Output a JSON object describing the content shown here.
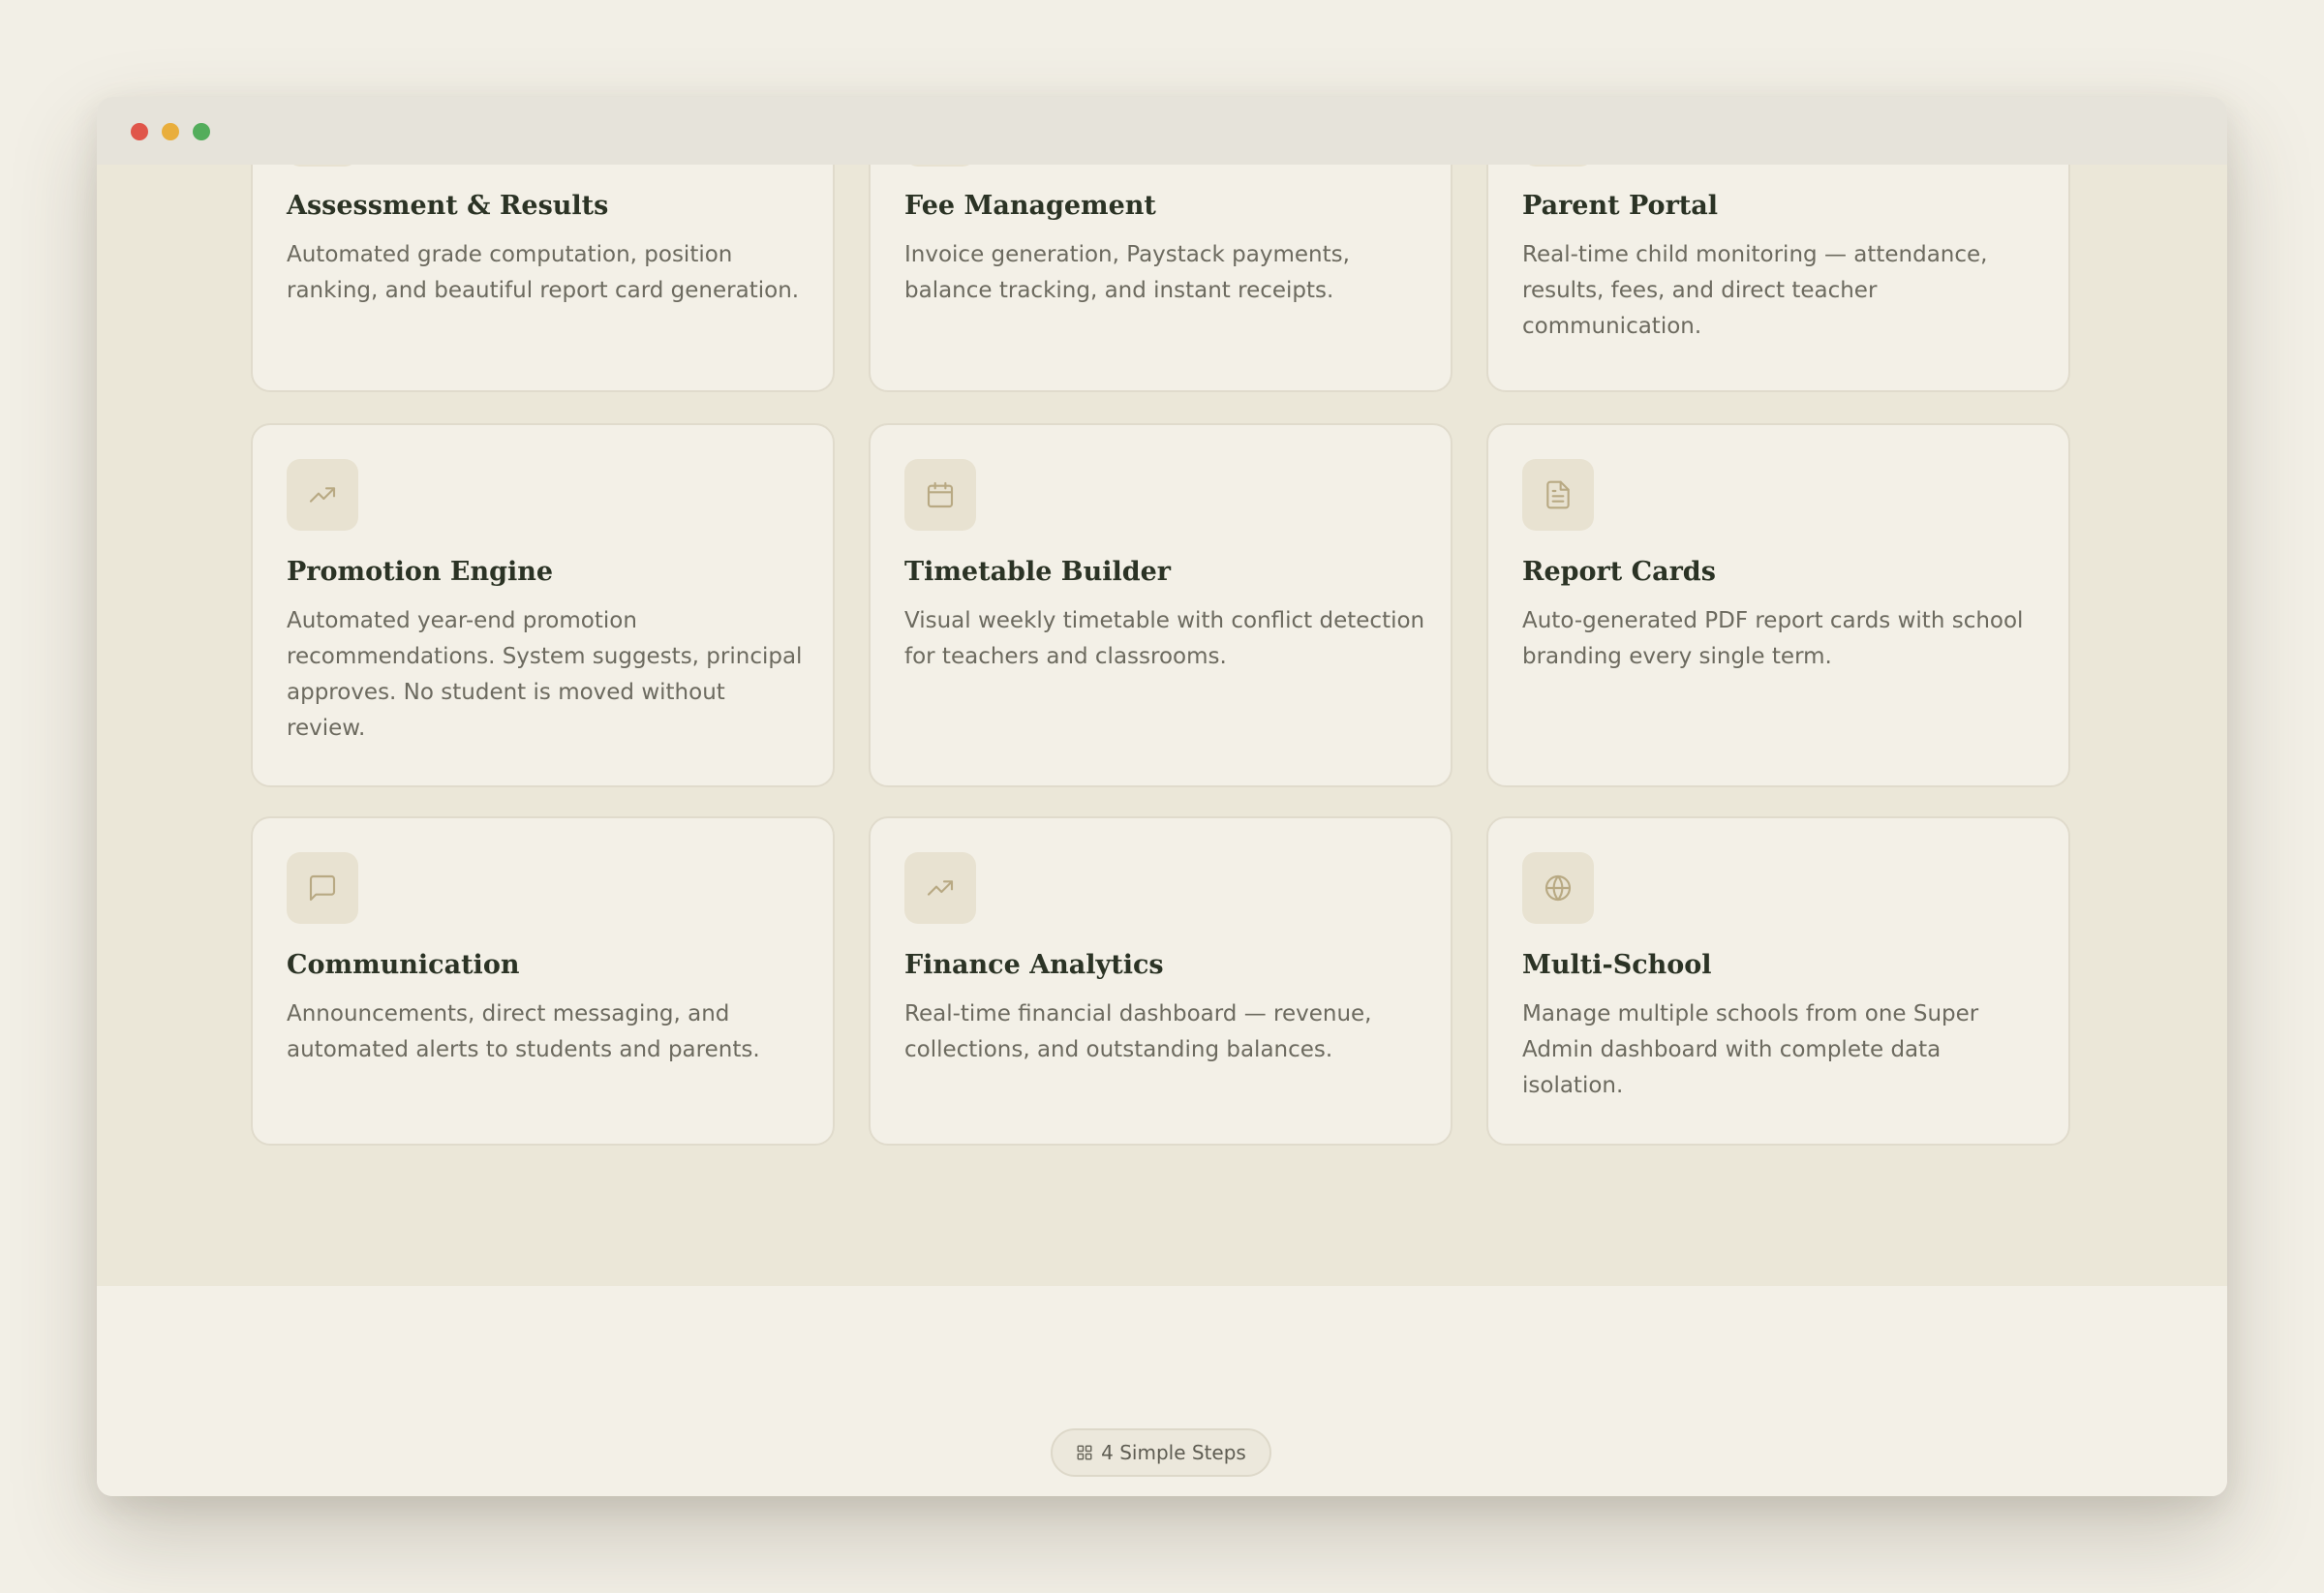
{
  "window": {
    "controls": [
      "close",
      "minimize",
      "maximize"
    ]
  },
  "features": [
    {
      "title": "Assessment & Results",
      "description": "Automated grade computation, position ranking, and beautiful report card generation."
    },
    {
      "title": "Fee Management",
      "description": "Invoice generation, Paystack payments, balance tracking, and instant receipts."
    },
    {
      "title": "Parent Portal",
      "description": "Real-time child monitoring — attendance, results, fees, and direct teacher communication."
    },
    {
      "title": "Promotion Engine",
      "icon": "trending-up-icon",
      "description": "Automated year-end promotion recommendations. System suggests, principal approves. No student is moved without review."
    },
    {
      "title": "Timetable Builder",
      "icon": "calendar-icon",
      "description": "Visual weekly timetable with conflict detection for teachers and classrooms."
    },
    {
      "title": "Report Cards",
      "icon": "file-text-icon",
      "description": "Auto-generated PDF report cards with school branding every single term."
    },
    {
      "title": "Communication",
      "icon": "message-square-icon",
      "description": "Announcements, direct messaging, and automated alerts to students and parents."
    },
    {
      "title": "Finance Analytics",
      "icon": "trending-up-icon",
      "description": "Real-time financial dashboard — revenue, collections, and outstanding balances."
    },
    {
      "title": "Multi-School",
      "icon": "globe-icon",
      "description": "Manage multiple schools from one Super Admin dashboard with complete data isolation."
    }
  ],
  "steps_badge": {
    "icon": "grid-icon",
    "label": "4 Simple Steps"
  },
  "colors": {
    "page_bg": "#f2efe6",
    "section_bg": "#ebe7d8",
    "card_bg": "#f3f0e7",
    "icon_accent": "#b8a983",
    "title_text": "#2b3325",
    "body_text": "#6c6a5f"
  }
}
